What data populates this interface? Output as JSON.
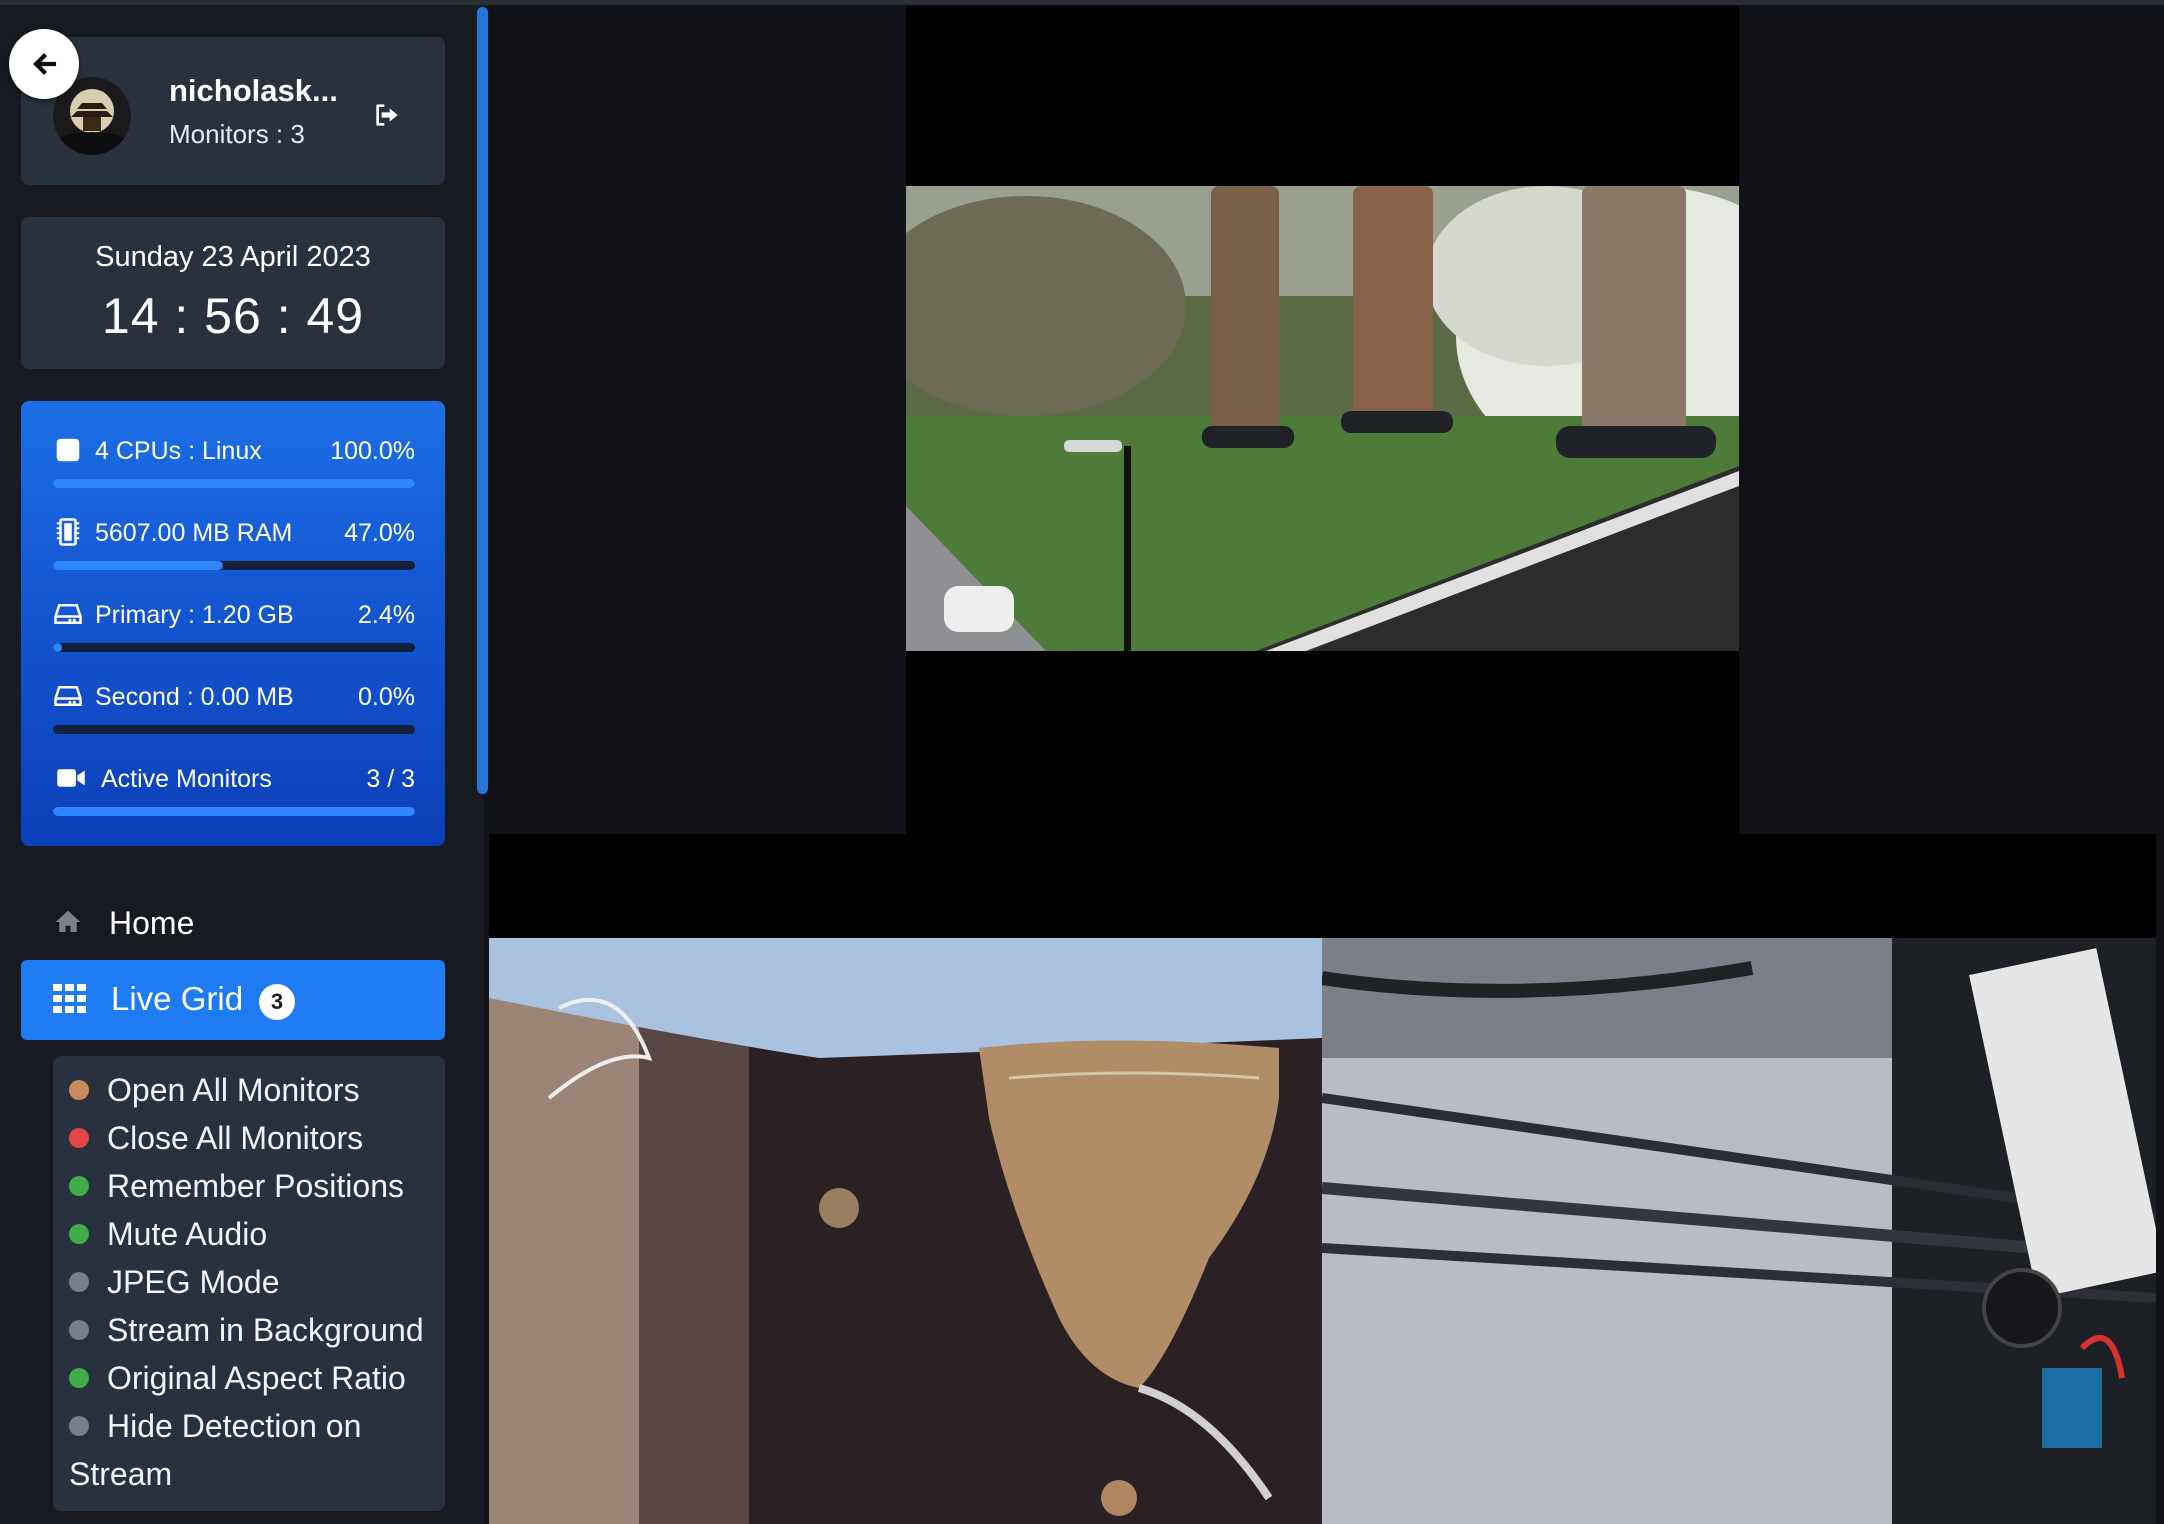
{
  "user": {
    "name": "nicholask...",
    "monitors_label": "Monitors : 3"
  },
  "clock": {
    "date": "Sunday 23 April 2023",
    "time": "14 : 56 : 49"
  },
  "stats": [
    {
      "icon": "cpu-square-icon",
      "label": "4 CPUs : Linux",
      "value": "100.0%",
      "fill": 1.0
    },
    {
      "icon": "memory-chip-icon",
      "label": "5607.00 MB RAM",
      "value": "47.0%",
      "fill": 0.47
    },
    {
      "icon": "hard-drive-icon",
      "label": "Primary : 1.20 GB",
      "value": "2.4%",
      "fill": 0.024
    },
    {
      "icon": "hard-drive-icon",
      "label": "Second : 0.00 MB",
      "value": "0.0%",
      "fill": 0.0
    },
    {
      "icon": "video-camera-icon",
      "label": "Active Monitors",
      "value": "3 / 3",
      "fill": 1.0
    }
  ],
  "nav": {
    "home_label": "Home",
    "live_grid_label": "Live Grid",
    "live_grid_count": "3"
  },
  "options": [
    {
      "label": "Open All Monitors",
      "dot": "#c98b5a"
    },
    {
      "label": "Close All Monitors",
      "dot": "#e04646"
    },
    {
      "label": "Remember Positions",
      "dot": "#3fae49"
    },
    {
      "label": "Mute Audio",
      "dot": "#3fae49"
    },
    {
      "label": "JPEG Mode",
      "dot": "#7a7f87"
    },
    {
      "label": "Stream in Background",
      "dot": "#7a7f87"
    },
    {
      "label": "Original Aspect Ratio",
      "dot": "#3fae49"
    },
    {
      "label": "Hide Detection on Stream",
      "dot": "#7a7f87"
    }
  ],
  "colors": {
    "accent": "#1f7bf2",
    "sidebar_bg": "#171b21",
    "card_bg": "#28313d"
  }
}
